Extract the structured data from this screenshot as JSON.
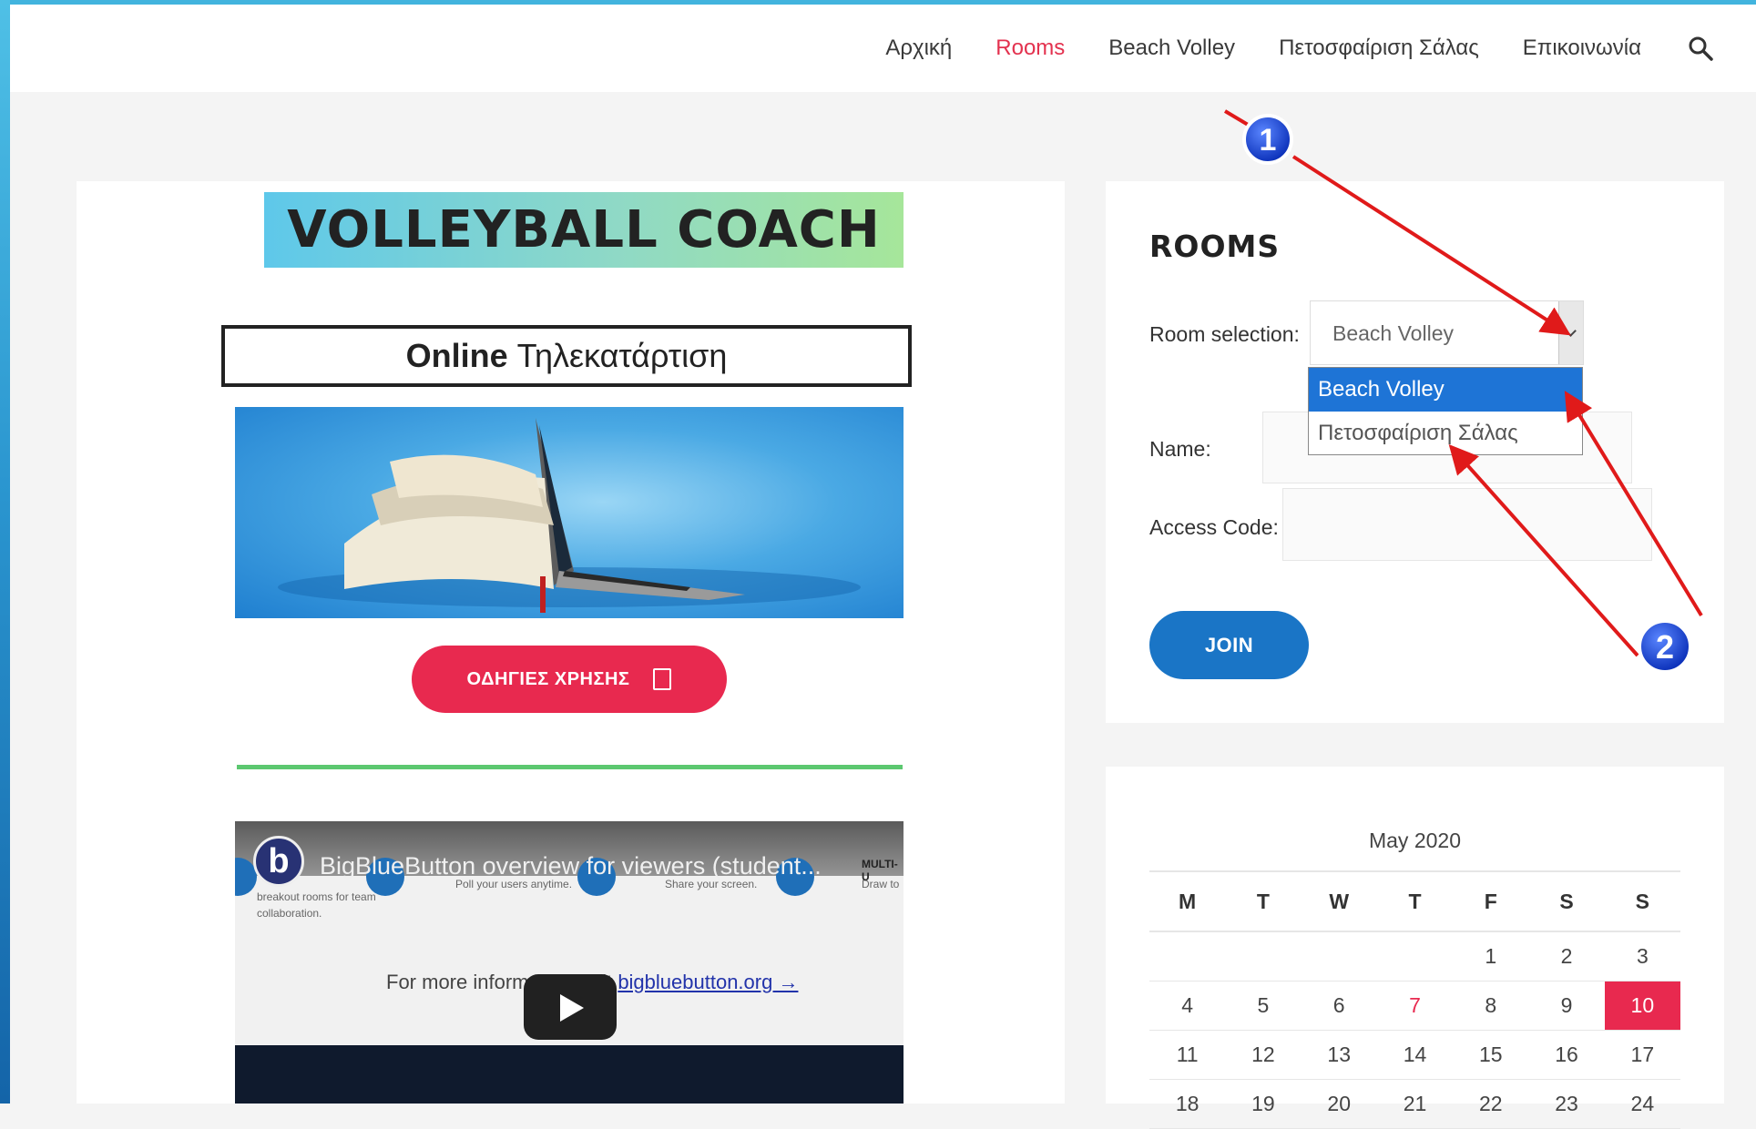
{
  "nav": {
    "items": [
      {
        "label": "Αρχική",
        "active": false
      },
      {
        "label": "Rooms",
        "active": true
      },
      {
        "label": "Beach Volley",
        "active": false
      },
      {
        "label": "Πετοσφαίριση Σάλας",
        "active": false
      },
      {
        "label": "Επικοινωνία",
        "active": false
      }
    ],
    "search_icon": "search-icon"
  },
  "main": {
    "banner_title": "VOLLEYBALL COACH",
    "online_bold": "Online",
    "online_rest": "Τηλεκατάρτιση",
    "guide_button": "ΟΔΗΓΙΕΣ ΧΡΗΣΗΣ",
    "video": {
      "title": "BigBlueButton overview for viewers (student...",
      "logo_letter": "b",
      "more_info_text": "For more information visit",
      "more_info_link": "bigbluebutton.org →",
      "snippets": [
        "breakout rooms for team",
        "collaboration.",
        "Poll your users anytime.",
        "Share your screen.",
        "Draw to",
        "MULTI-U"
      ]
    }
  },
  "rooms": {
    "title": "ROOMS",
    "room_selection_label": "Room selection:",
    "selected_room": "Beach Volley",
    "options": [
      "Beach Volley",
      "Πετοσφαίριση Σάλας"
    ],
    "name_label": "Name:",
    "access_code_label": "Access Code:",
    "join_label": "JOIN"
  },
  "calendar": {
    "caption": "May 2020",
    "days": [
      "M",
      "T",
      "W",
      "T",
      "F",
      "S",
      "S"
    ],
    "weeks": [
      [
        "",
        "",
        "",
        "",
        "1",
        "2",
        "3"
      ],
      [
        "4",
        "5",
        "6",
        "7",
        "8",
        "9",
        "10"
      ],
      [
        "11",
        "12",
        "13",
        "14",
        "15",
        "16",
        "17"
      ],
      [
        "18",
        "19",
        "20",
        "21",
        "22",
        "23",
        "24"
      ]
    ],
    "highlight_day": "7",
    "today": "10"
  },
  "annotations": {
    "marker_1": "1",
    "marker_2": "2"
  },
  "colors": {
    "accent": "#e8294f",
    "primary": "#1a75c6",
    "arrow": "#e01a1a"
  }
}
